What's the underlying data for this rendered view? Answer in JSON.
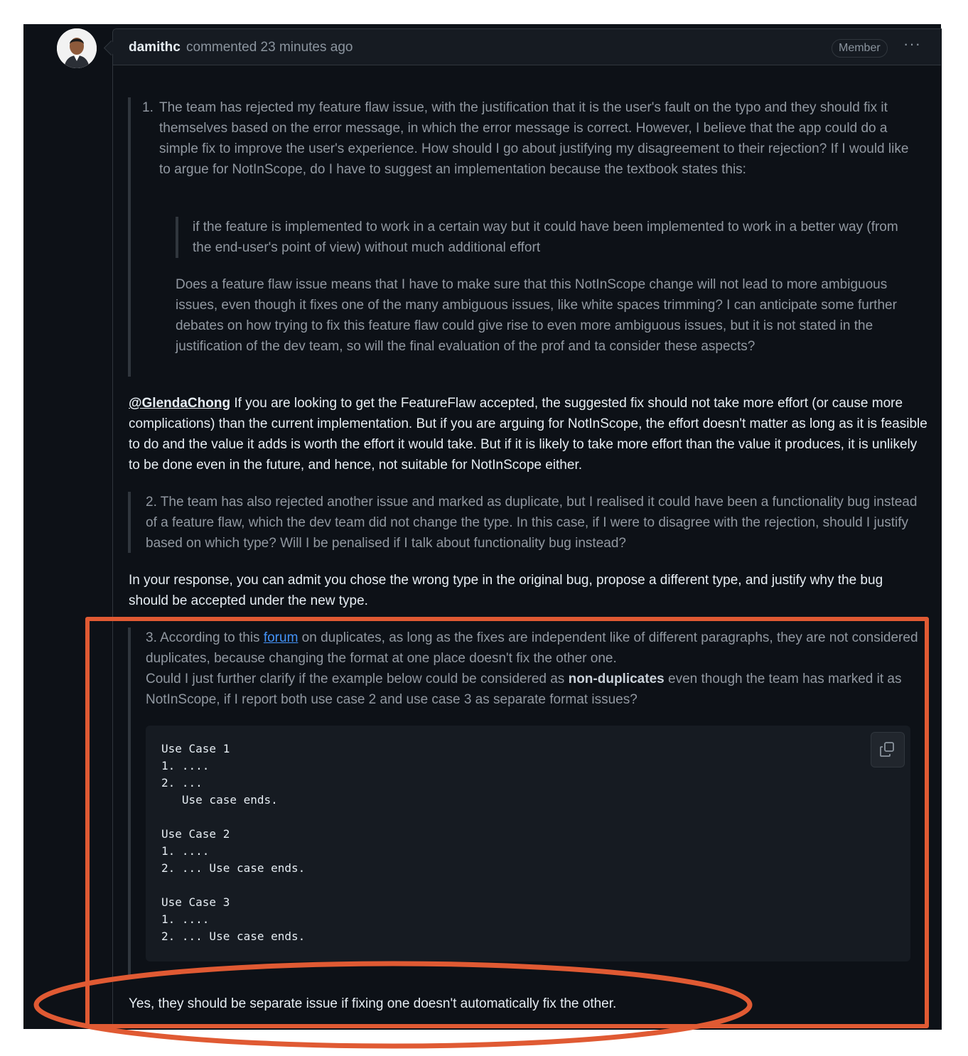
{
  "comment": {
    "author": "damithc",
    "meta": "commented 23 minutes ago",
    "badge": "Member",
    "menu": "···"
  },
  "quote1": {
    "number": "1.",
    "text": "The team has rejected my feature flaw issue, with the justification that it is the user's fault on the typo and they should fix it themselves based on the error message, in which the error message is correct. However, I believe that the app could do a simple fix to improve the user's experience. How should I go about justifying my disagreement to their rejection? If I would like to argue for NotInScope, do I have to suggest an implementation because the textbook states this:",
    "nested_quote": "if the feature is implemented to work in a certain way but it could have been implemented to work in a better way (from the end-user's point of view) without much additional effort",
    "follow_up": "Does a feature flaw issue means that I have to make sure that this NotInScope change will not lead to more ambiguous issues, even though it fixes one of the many ambiguous issues, like white spaces trimming? I can anticipate some further debates on how trying to fix this feature flaw could give rise to even more ambiguous issues, but it is not stated in the justification of the dev team, so will the final evaluation of the prof and ta consider these aspects?"
  },
  "reply1": {
    "mention": "@GlendaChong",
    "text": " If you are looking to get the FeatureFlaw accepted, the suggested fix should not take more effort (or cause more complications) than the current implementation. But if you are arguing for NotInScope, the effort doesn't matter as long as it is feasible to do and the value it adds is worth the effort it would take. But if it is likely to take more effort than the value it produces, it is unlikely to be done even in the future, and hence, not suitable for NotInScope either."
  },
  "quote2": {
    "text": "2. The team has also rejected another issue and marked as duplicate, but I realised it could have been a functionality bug instead of a feature flaw, which the dev team did not change the type. In this case, if I were to disagree with the rejection, should I justify based on which type? Will I be penalised if I talk about functionality bug instead?"
  },
  "reply2": {
    "text": "In your response, you can admit you chose the wrong type in the original bug, propose a different type, and justify why the bug should be accepted under the new type."
  },
  "quote3": {
    "prefix": "3. According to this ",
    "link": "forum",
    "suffix": " on duplicates, as long as the fixes are independent like of different paragraphs, they are not considered duplicates, because changing the format at one place doesn't fix the other one.",
    "line2_prefix": "Could I just further clarify if the example below could be considered as ",
    "line2_bold": "non-duplicates",
    "line2_suffix": " even though the team has marked it as NotInScope, if I report both use case 2 and use case 3 as separate format issues?",
    "code": "Use Case 1\n1. ....\n2. ...\n   Use case ends.\n\nUse Case 2\n1. ....\n2. ... Use case ends.\n\nUse Case 3\n1. ....\n2. ... Use case ends."
  },
  "reply3": {
    "text": "Yes, they should be separate issue if fixing one doesn't automatically fix the other."
  },
  "annotation": {
    "color": "#e05a33"
  }
}
